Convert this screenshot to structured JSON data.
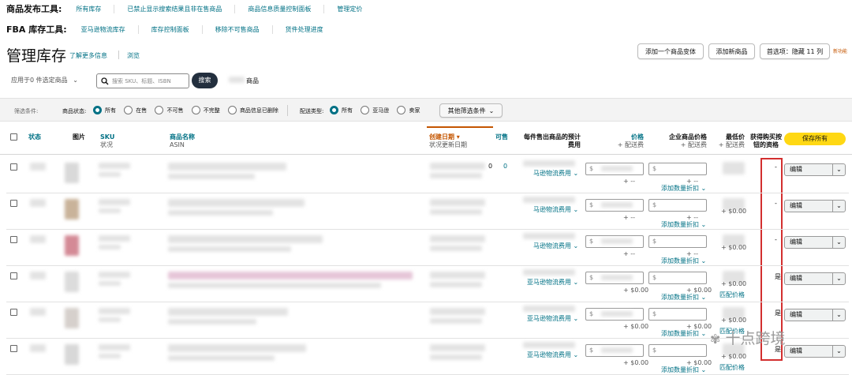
{
  "tools": {
    "product_label": "商品发布工具:",
    "product_links": [
      "所有库存",
      "已禁止显示搜索结果且非在售商品",
      "商品信息质量控制面板",
      "管理定价"
    ],
    "fba_label": "FBA 库存工具:",
    "fba_links": [
      "亚马逊物流库存",
      "库存控制面板",
      "移除不可售商品",
      "货件处理进度"
    ]
  },
  "header": {
    "title": "管理库存",
    "learn_more": "了解更多信息",
    "browse": "浏览",
    "btn_add_variant": "添加一个商品变体",
    "btn_add_product": "添加新商品",
    "btn_preferences": "首选项：隐藏 11 列",
    "new_features": "新功能"
  },
  "search": {
    "apply_label": "应用于0 件选定商品",
    "placeholder": "搜索 SKU、标题、ISBN",
    "search_button": "搜索",
    "count_suffix": "商品"
  },
  "filters": {
    "label": "筛选条件:",
    "status_label": "商品状态:",
    "status_options": [
      "所有",
      "在售",
      "不可售",
      "不完整",
      "商品信息已删除"
    ],
    "status_selected": "所有",
    "fulfill_label": "配送类型:",
    "fulfill_options": [
      "所有",
      "亚马逊",
      "卖家"
    ],
    "fulfill_selected": "所有",
    "more_filters": "其他筛选条件"
  },
  "table": {
    "headers": {
      "status": "状态",
      "image": "图片",
      "sku": "SKU",
      "sku_sub": "状况",
      "name": "商品名称",
      "name_sub": "ASIN",
      "created": "创建日期 ▾",
      "created_sub": "状况更新日期",
      "available": "可售",
      "fee": "每件售出商品的预计费用",
      "price": "价格",
      "price_sub": "+ 配送费",
      "biz_price": "企业商品价格",
      "biz_sub": "+ 配送费",
      "lowest": "最低价",
      "lowest_sub": "+ 配送费",
      "buybox": "获得购买按钮的资格",
      "save_all": "保存所有"
    },
    "rows": [
      {
        "fee": "马逊物流费用",
        "dollar": "$",
        "dash": "+ --",
        "biz_note": "添加数量折扣",
        "lowest": "",
        "match": "",
        "buybox": "-",
        "edit": "编辑",
        "avail": "0",
        "extra": "0"
      },
      {
        "fee": "马逊物流费用",
        "dollar": "$",
        "dash": "+ --",
        "biz_note": "添加数量折扣",
        "lowest": "+ $0.00",
        "match": "",
        "buybox": "-",
        "edit": "编辑",
        "avail": "",
        "extra": ""
      },
      {
        "fee": "马逊物流费用",
        "dollar": "$",
        "dash": "+ --",
        "biz_note": "添加数量折扣",
        "lowest": "+ $0.00",
        "match": "",
        "buybox": "-",
        "edit": "编辑",
        "avail": "",
        "extra": ""
      },
      {
        "fee": "亚马逊物流费用",
        "dollar": "$",
        "dash": "+ $0.00",
        "biz_note": "添加数量折扣",
        "lowest": "+ $0.00",
        "match": "匹配价格",
        "buybox": "是",
        "edit": "编辑",
        "avail": "",
        "extra": ""
      },
      {
        "fee": "亚马逊物流费用",
        "dollar": "$",
        "dash": "+ $0.00",
        "biz_note": "添加数量折扣",
        "lowest": "+ $0.00",
        "match": "匹配价格",
        "buybox": "是",
        "edit": "编辑",
        "avail": "",
        "extra": ""
      },
      {
        "fee": "亚马逊物流费用",
        "dollar": "$",
        "dash": "+ $0.00",
        "biz_note": "添加数量折扣",
        "lowest": "+ $0.00",
        "match": "匹配价格",
        "buybox": "是",
        "edit": "编辑",
        "avail": "",
        "extra": ""
      }
    ]
  },
  "watermark": "十点跨境",
  "colors": {
    "teal": "#007185",
    "orange": "#c45500",
    "highlight_border": "#d32f2f",
    "save_all_bg": "#ffd814"
  }
}
